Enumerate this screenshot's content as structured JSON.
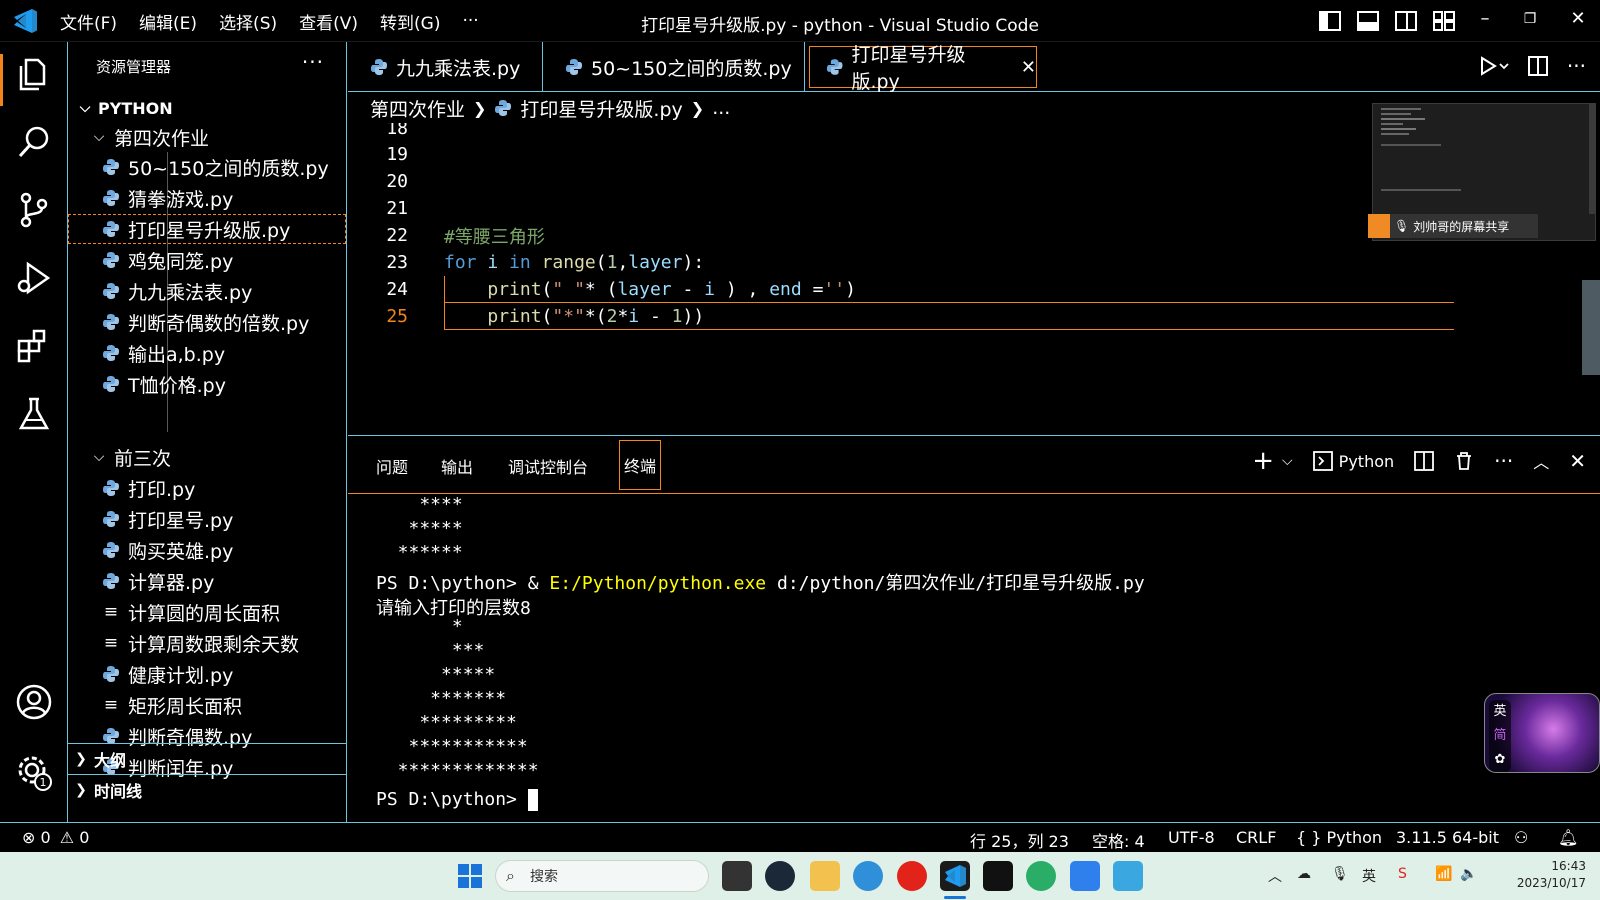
{
  "titlebar": {
    "menu": [
      "文件(F)",
      "编辑(E)",
      "选择(S)",
      "查看(V)",
      "转到(G)",
      "···"
    ],
    "window_title": "打印星号升级版.py - python - Visual Studio Code"
  },
  "sidebar": {
    "header": "资源管理器",
    "more": "···",
    "root": "PYTHON",
    "folder1": "第四次作业",
    "folder1_files": [
      "50~150之间的质数.py",
      "猜拳游戏.py",
      "打印星号升级版.py",
      "鸡兔同笼.py",
      "九九乘法表.py",
      "判断奇偶数的倍数.py",
      "输出a,b.py",
      "T恤价格.py"
    ],
    "folder2": "前三次",
    "folder2_files": [
      {
        "name": "打印.py",
        "icon": "python-icon"
      },
      {
        "name": "打印星号.py",
        "icon": "python-icon"
      },
      {
        "name": "购买英雄.py",
        "icon": "python-icon"
      },
      {
        "name": "计算器.py",
        "icon": "python-icon"
      },
      {
        "name": "计算圆的周长面积",
        "icon": "text-file-icon"
      },
      {
        "name": "计算周数跟剩余天数",
        "icon": "text-file-icon"
      },
      {
        "name": "健康计划.py",
        "icon": "python-icon"
      },
      {
        "name": "矩形周长面积",
        "icon": "text-file-icon"
      },
      {
        "name": "判断奇偶数.py",
        "icon": "python-icon"
      },
      {
        "name": "判断闰年.py",
        "icon": "python-icon"
      }
    ],
    "outline": "大纲",
    "timeline": "时间线"
  },
  "tabs": [
    {
      "label": "九九乘法表.py"
    },
    {
      "label": "50~150之间的质数.py"
    },
    {
      "label": "打印星号升级版.py",
      "close": "✕"
    }
  ],
  "breadcrumb": {
    "folder": "第四次作业",
    "file": "打印星号升级版.py",
    "more": "..."
  },
  "editor": {
    "line_numbers": [
      "18",
      "19",
      "20",
      "21",
      "22",
      "23",
      "24",
      "25"
    ],
    "comment_line": "#等腰三角形"
  },
  "minimap": {
    "share_label": "刘帅哥的屏幕共享"
  },
  "panel": {
    "tabs": [
      "问题",
      "输出",
      "调试控制台",
      "终端"
    ],
    "shell_label": "Python"
  },
  "terminal": {
    "lines_top": [
      "    ****",
      "   *****",
      "  ******"
    ],
    "prompt1_ps": "PS D:\\python> & ",
    "prompt1_exe": "E:/Python/python.exe",
    "prompt1_arg": " d:/python/第四次作业/打印星号升级版.py",
    "input_prompt": "请输入打印的层数8",
    "triangle": [
      "       *",
      "       ***",
      "      *****",
      "     *******",
      "    *********",
      "   ***********",
      "  *************"
    ],
    "prompt2": "PS D:\\python> "
  },
  "statusbar": {
    "errors": "0",
    "warnings": "0",
    "position": "行 25，列 23",
    "spaces": "空格: 4",
    "encoding": "UTF-8",
    "eol": "CRLF",
    "language": "Python",
    "interpreter": "3.11.5 64-bit"
  },
  "taskbar": {
    "search_placeholder": "搜索",
    "time": "16:43",
    "date": "2023/10/17",
    "ime_lang": "英",
    "ime_mode": "简"
  },
  "colors": {
    "accent_border": "#6fc3df",
    "focus_orange": "#f38518",
    "comment": "#7ca668",
    "keyword": "#569cd6"
  }
}
